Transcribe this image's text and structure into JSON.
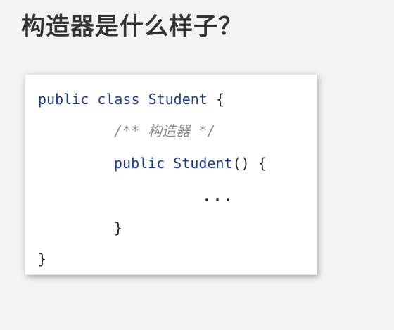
{
  "slide": {
    "title": "构造器是什么样子？",
    "code": {
      "line1": {
        "kw1": "public",
        "kw2": "class",
        "name": "Student",
        "brace": "{"
      },
      "line2": {
        "comment": "/** 构造器 */"
      },
      "line3": {
        "kw1": "public",
        "name": "Student",
        "parens": "()",
        "brace": "{"
      },
      "line4": {
        "body": "..."
      },
      "line5": {
        "brace": "}"
      },
      "line6": {
        "brace": "}"
      }
    }
  }
}
